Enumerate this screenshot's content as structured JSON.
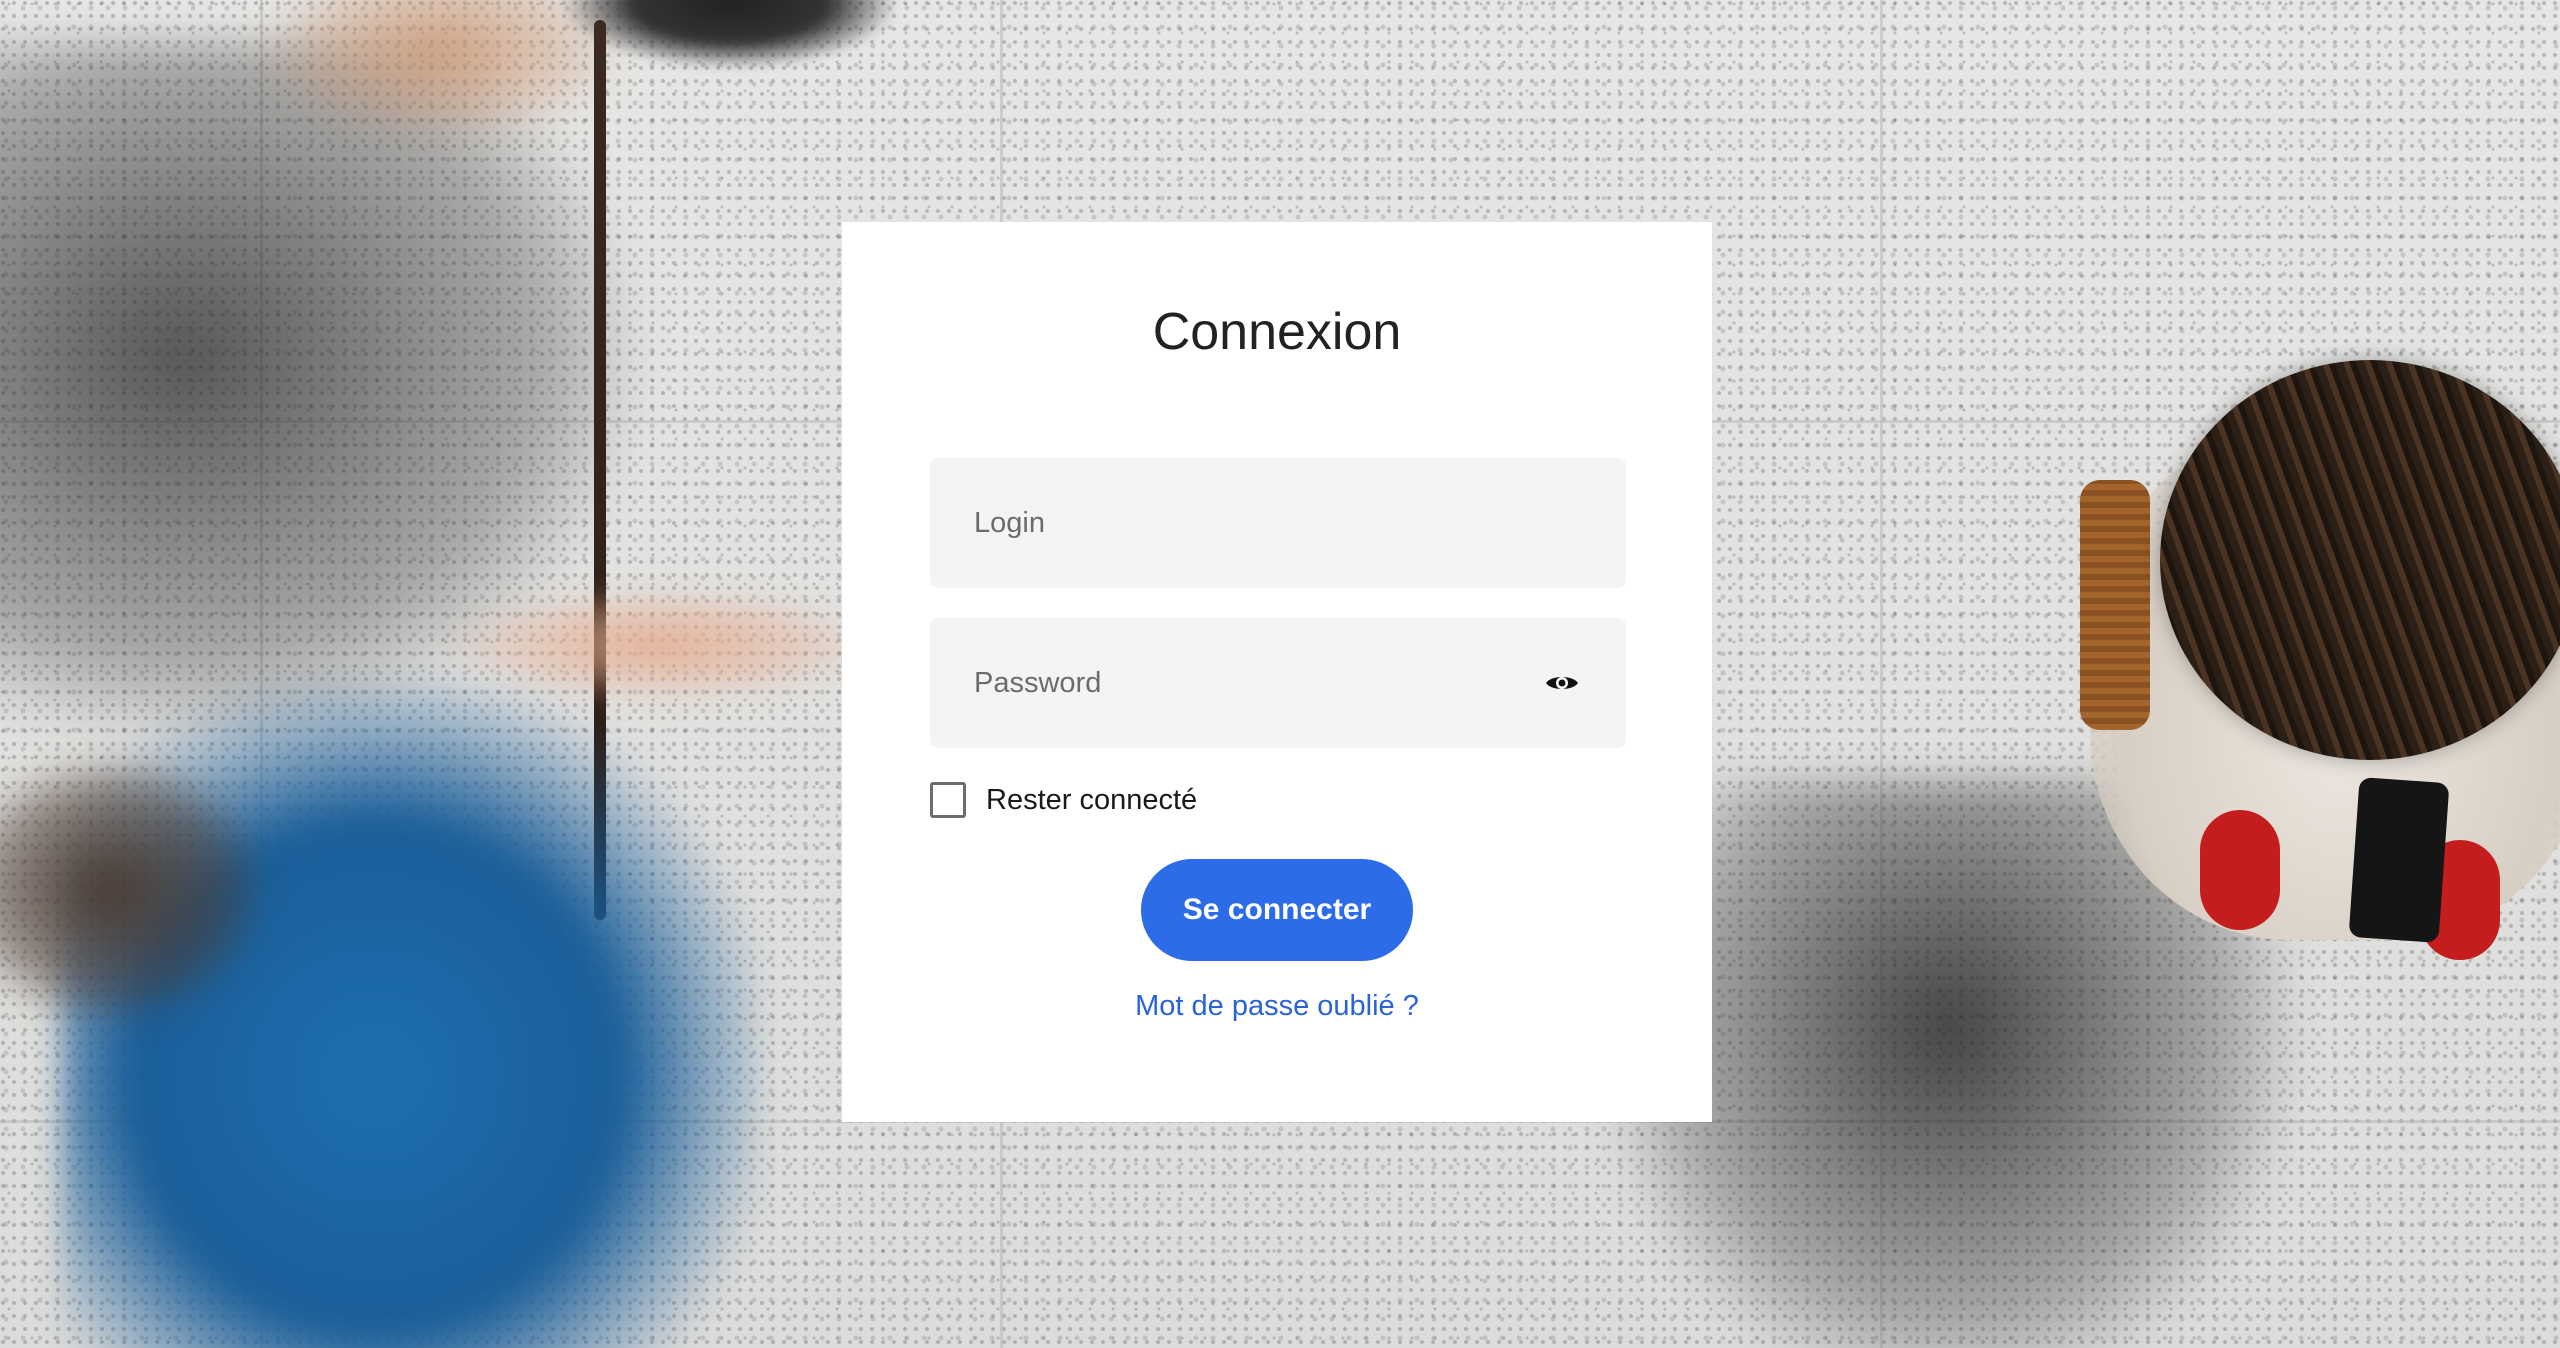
{
  "login_card": {
    "title": "Connexion",
    "login_placeholder": "Login",
    "password_placeholder": "Password",
    "remember_label": "Rester connecté",
    "remember_checked": false,
    "submit_label": "Se connecter",
    "forgot_label": "Mot de passe oublié ?",
    "show_password_icon": "eye-icon"
  },
  "colors": {
    "primary_button": "#2d6ce9",
    "link": "#2a63d6",
    "input_background": "#f3f4f6",
    "card_background": "#ffffff"
  }
}
